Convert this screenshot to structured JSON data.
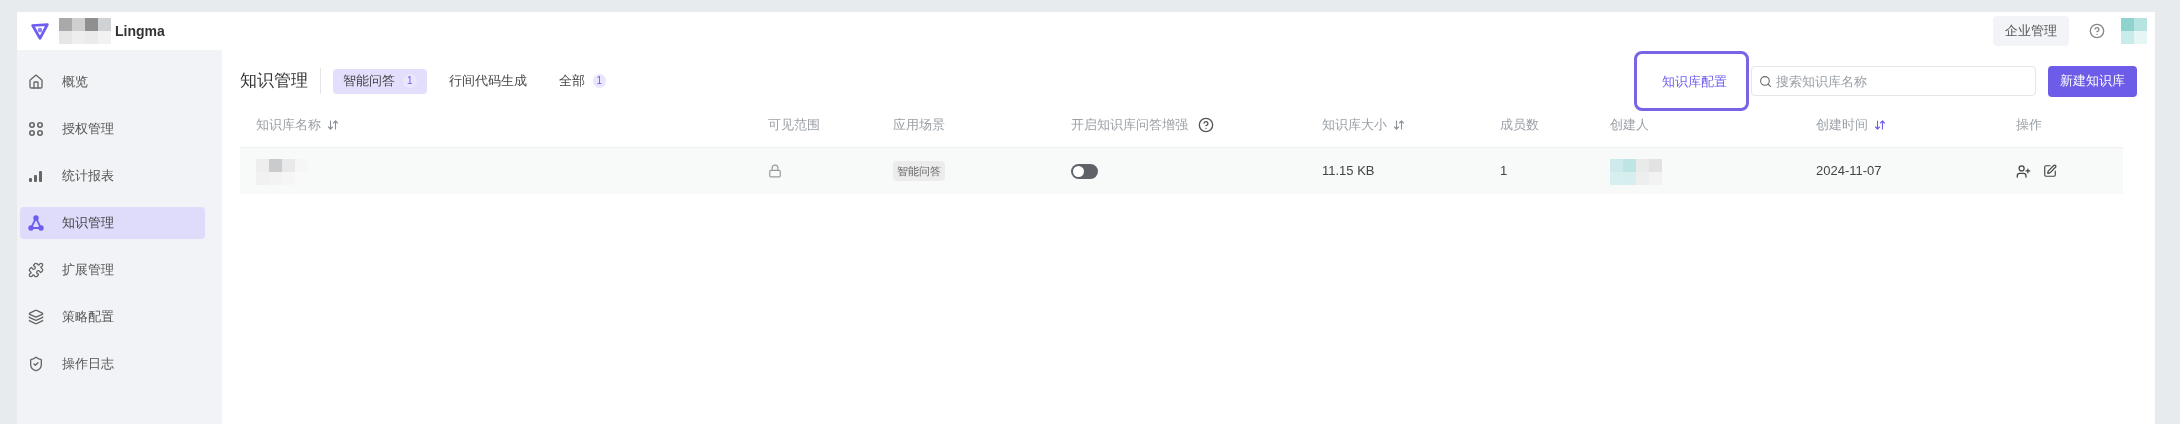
{
  "header": {
    "product": "Lingma",
    "buttons": [
      {
        "label": "企业管理"
      }
    ]
  },
  "sidebar": {
    "items": [
      {
        "label": "概览",
        "selected": false
      },
      {
        "label": "授权管理",
        "selected": false
      },
      {
        "label": "统计报表",
        "selected": false
      },
      {
        "label": "知识管理",
        "selected": true
      },
      {
        "label": "扩展管理",
        "selected": false
      },
      {
        "label": "策略配置",
        "selected": false
      },
      {
        "label": "操作日志",
        "selected": false
      }
    ]
  },
  "page": {
    "title": "知识管理",
    "tabs": [
      {
        "label": "智能问答",
        "count": "1",
        "selected": true
      },
      {
        "label": "行间代码生成",
        "selected": false
      },
      {
        "label": "全部",
        "count": "1",
        "selected": false
      }
    ],
    "config_link": {
      "label": "知识库配置",
      "highlighted": true
    },
    "search": {
      "placeholder": "搜索知识库名称"
    },
    "create_button": "新建知识库"
  },
  "table": {
    "columns": [
      {
        "label": "知识库名称",
        "sortable": true,
        "sort_active": false
      },
      {
        "label": "可见范围"
      },
      {
        "label": "应用场景"
      },
      {
        "label": "开启知识库问答增强",
        "help": true
      },
      {
        "label": "知识库大小",
        "sortable": true,
        "sort_active": false
      },
      {
        "label": "成员数"
      },
      {
        "label": "创建人"
      },
      {
        "label": "创建时间",
        "sortable": true,
        "sort_active": true
      },
      {
        "label": "操作"
      }
    ],
    "rows": [
      {
        "scene": "智能问答",
        "enhanced": false,
        "size": "11.15 KB",
        "members": "1",
        "created": "2024-11-07"
      }
    ]
  }
}
